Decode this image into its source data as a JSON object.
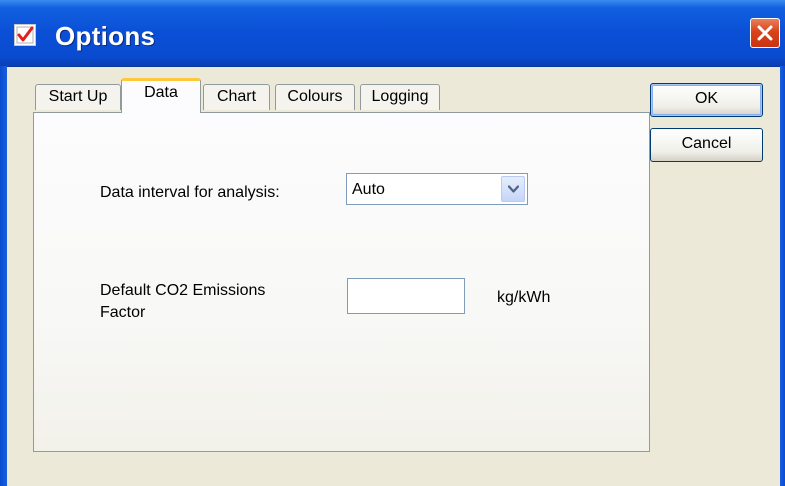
{
  "window": {
    "title": "Options",
    "icon": "options-app-icon",
    "close_icon": "close-icon"
  },
  "tabs": [
    {
      "label": "Start Up",
      "selected": false
    },
    {
      "label": "Data",
      "selected": true
    },
    {
      "label": "Chart",
      "selected": false
    },
    {
      "label": "Colours",
      "selected": false
    },
    {
      "label": "Logging",
      "selected": false
    }
  ],
  "data_tab": {
    "interval_label": "Data interval for analysis:",
    "interval_value": "Auto",
    "co2_label_line1": "Default CO2 Emissions",
    "co2_label_line2": "Factor",
    "co2_value": "",
    "co2_unit": "kg/kWh"
  },
  "buttons": {
    "ok": "OK",
    "cancel": "Cancel"
  },
  "colors": {
    "titlebar": "#0a4fd6",
    "selected_tab_accent": "#ffc83c",
    "close_button": "#d9431a"
  }
}
